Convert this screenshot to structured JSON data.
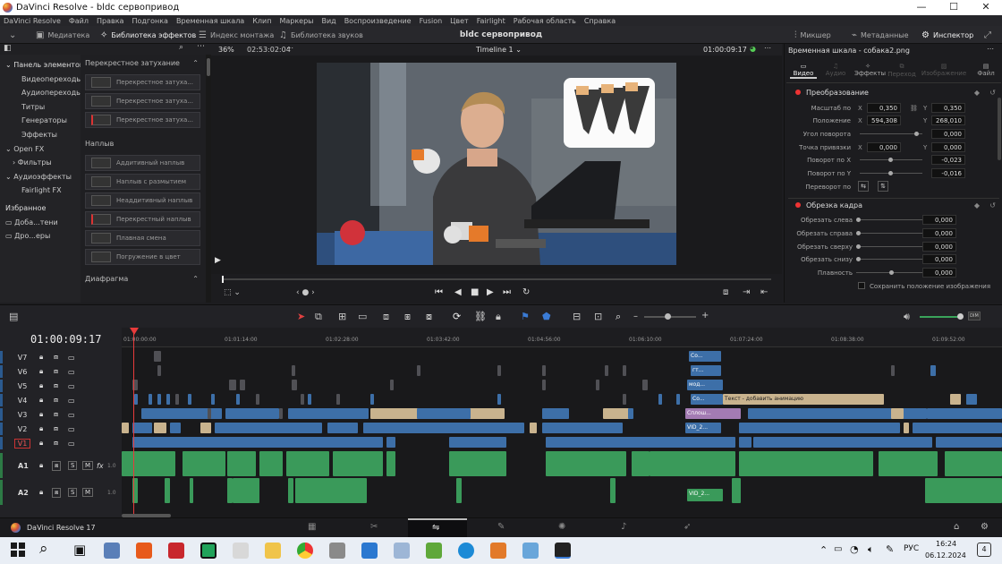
{
  "window": {
    "title": "DaVinci Resolve - bldc сервопривод",
    "min": "—",
    "max": "☐",
    "close": "✕"
  },
  "menu": [
    "DaVinci Resolve",
    "Файл",
    "Правка",
    "Подгонка",
    "Временная шкала",
    "Клип",
    "Маркеры",
    "Вид",
    "Воспроизведение",
    "Fusion",
    "Цвет",
    "Fairlight",
    "Рабочая область",
    "Справка"
  ],
  "toolbar": {
    "media": "Медиатека",
    "effects": "Библиотека эффектов",
    "edit_index": "Индекс монтажа",
    "sound_lib": "Библиотека звуков",
    "project_title": "bldc сервопривод",
    "mixer": "Микшер",
    "metadata": "Метаданные",
    "inspector": "Инспектор"
  },
  "viewer": {
    "zoom": "36%",
    "source_tc": "02:53:02:04",
    "timeline_name": "Timeline 1",
    "timecode": "01:00:09:17"
  },
  "effects_tree": {
    "items": [
      "Панель элементов",
      "Видеопереходы",
      "Аудиопереходы",
      "Титры",
      "Генераторы",
      "Эффекты",
      "Open FX",
      "Фильтры",
      "Аудиоэффекты",
      "Fairlight FX"
    ],
    "favorites": "Избранное",
    "fav_items": [
      "Доба...тени",
      "Дро...еры"
    ]
  },
  "effects_list": {
    "cross_head": "Перекрестное затухание",
    "cross_items": [
      "Перекрестное затуха...",
      "Перекрестное затуха...",
      "Перекрестное затуха..."
    ],
    "dissolve_head": "Наплыв",
    "dissolve_items": [
      "Аддитивный наплыв",
      "Наплыв с размытием",
      "Неаддитивный наплыв",
      "Перекрестный наплыв",
      "Плавная смена",
      "Погружение в цвет"
    ],
    "iris_head": "Диафрагма"
  },
  "inspector": {
    "title": "Временная шкала - собака2.png",
    "tabs": [
      "Видео",
      "Аудио",
      "Эффекты",
      "Переход",
      "Изображение",
      "Файл"
    ],
    "transform": "Преобразование",
    "zoom_label": "Масштаб по",
    "zoom_x": "0,350",
    "zoom_y": "0,350",
    "pos_label": "Положение",
    "pos_x": "594,308",
    "pos_y": "268,010",
    "rot_label": "Угол поворота",
    "rot": "0,000",
    "anchor_label": "Точка привязки",
    "anchor_x": "0,000",
    "anchor_y": "0,000",
    "pitch_label": "Поворот по X",
    "pitch": "-0,023",
    "yaw_label": "Поворот по Y",
    "yaw": "-0,016",
    "flip_label": "Переворот по",
    "crop": "Обрезка кадра",
    "crop_l_label": "Обрезать слева",
    "crop_l": "0,000",
    "crop_r_label": "Обрезать справа",
    "crop_r": "0,000",
    "crop_t_label": "Обрезать сверху",
    "crop_t": "0,000",
    "crop_b_label": "Обрезать снизу",
    "crop_b": "0,000",
    "soft_label": "Плавность",
    "soft": "0,000",
    "retain_label": "Сохранить положение изображения",
    "x": "X",
    "y": "Y"
  },
  "timeline": {
    "timecode": "01:00:09:17",
    "ruler": [
      "01:00:00:00",
      "01:01:14:00",
      "01:02:28:00",
      "01:03:42:00",
      "01:04:56:00",
      "01:06:10:00",
      "01:07:24:00",
      "01:08:38:00",
      "01:09:52:00"
    ],
    "video_tracks": [
      "V7",
      "V6",
      "V5",
      "V4",
      "V3",
      "V2",
      "V1"
    ],
    "audio_tracks": [
      "A1",
      "A2"
    ],
    "audio_level": "1.0",
    "fx_label": "fx",
    "clips": {
      "c7": "Со...",
      "c6": "гт...",
      "c5": "мод...",
      "c4": "Со...",
      "title_clip": "Текст - добавить анимацию",
      "c3": "Сплош...",
      "c2": "VID_2...",
      "a2": "VID_2..."
    }
  },
  "pagebar": {
    "app": "DaVinci Resolve 17"
  },
  "taskbar": {
    "lang": "РУС",
    "time": "16:24",
    "date": "06.12.2024",
    "notif": "4"
  }
}
